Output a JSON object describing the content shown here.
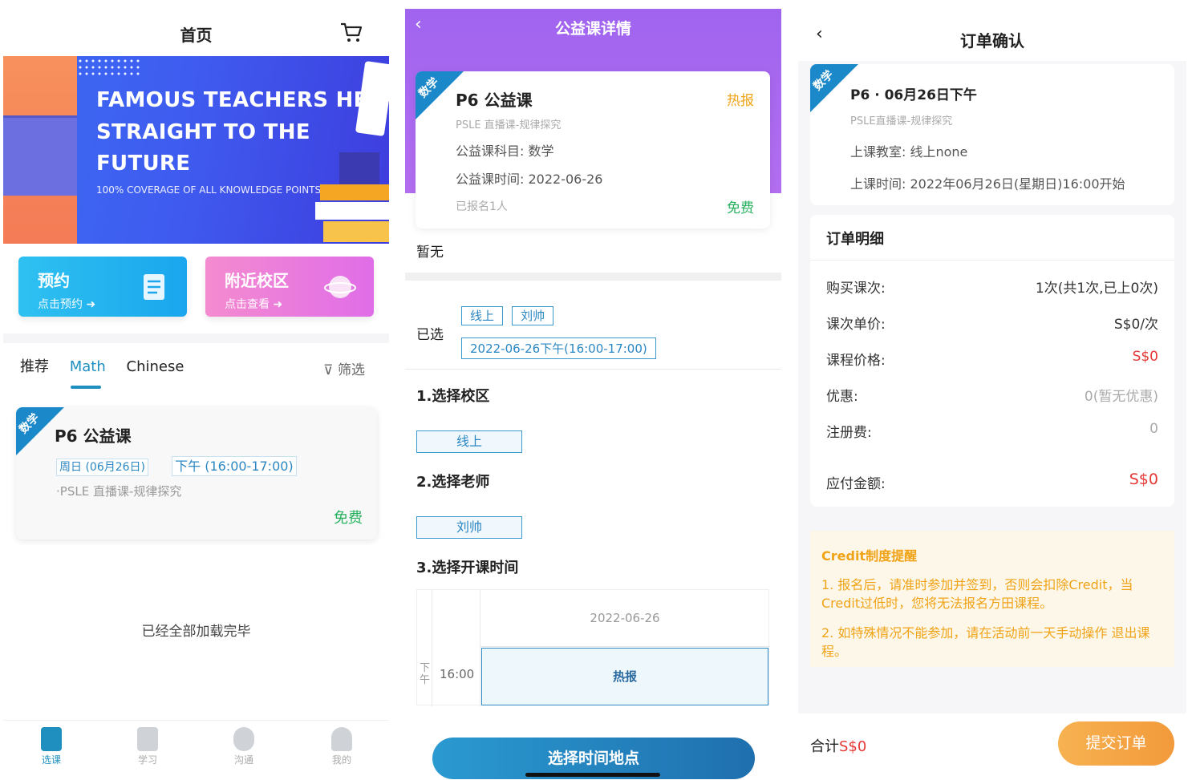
{
  "screen1": {
    "title": "首页",
    "banner": {
      "line1": "FAMOUS TEACHERS HELP",
      "line2": "STRAIGHT TO THE",
      "line3": "FUTURE",
      "subtitle": "100% COVERAGE OF ALL KNOWLEDGE POINTS"
    },
    "quick": [
      {
        "title": "预约",
        "sub": "点击预约"
      },
      {
        "title": "附近校区",
        "sub": "点击查看"
      }
    ],
    "tabs": [
      "推荐",
      "Math",
      "Chinese"
    ],
    "filter": "筛选",
    "course": {
      "corner": "数学",
      "title": "P6 公益课",
      "date_tag": "周日 (06月26日)",
      "time_tag": "下午 (16:00-17:00)",
      "subtitle": "·PSLE 直播课-规律探究",
      "price": "免费"
    },
    "loaded": "已经全部加载完毕",
    "nav": [
      "选课",
      "学习",
      "沟通",
      "我的"
    ]
  },
  "screen2": {
    "title": "公益课详情",
    "card": {
      "corner": "数学",
      "title": "P6 公益课",
      "hot": "热报",
      "subtitle": "PSLE 直播课-规律探究",
      "subject": "公益课科目: 数学",
      "time": "公益课时间: 2022-06-26",
      "enrolled": "已报名1人",
      "price": "免费"
    },
    "none": "暂无",
    "selected_label": "已选",
    "chips": [
      "线上",
      "刘帅"
    ],
    "chip_time": "2022-06-26下午(16:00-17:00)",
    "sec1": "1.选择校区",
    "opt1": "线上",
    "sec2": "2.选择老师",
    "opt2": "刘帅",
    "sec3": "3.选择开课时间",
    "grid": {
      "date": "2022-06-26",
      "period": "下午",
      "time": "16:00",
      "slot": "热报"
    },
    "button": "选择时间地点"
  },
  "screen3": {
    "title": "订单确认",
    "card": {
      "corner": "数学",
      "title": "P6 · 06月26日下午",
      "subtitle": "PSLE直播课-规律探究",
      "room": "上课教室:  线上none",
      "time": "上课时间:  2022年06月26日(星期日)16:00开始"
    },
    "detail_title": "订单明细",
    "rows": [
      {
        "label": "购买课次:",
        "value": "1次(共1次,已上0次)"
      },
      {
        "label": "课次单价:",
        "value": "S$0/次"
      },
      {
        "label": "课程价格:",
        "value": "S$0"
      },
      {
        "label": "优惠:",
        "value": "0(暂无优惠)"
      },
      {
        "label": "注册费:",
        "value": "0"
      },
      {
        "label": "应付金额:",
        "value": "S$0"
      }
    ],
    "credit": {
      "title": "Credit制度提醒",
      "p1": "1. 报名后，请准时参加并签到，否则会扣除Credit，当Credit过低时，您将无法报名方田课程。",
      "p2": "2. 如特殊情况不能参加，请在活动前一天手动操作 退出课程。"
    },
    "total_label": "合计",
    "total_value": "S$0",
    "submit": "提交订单"
  },
  "colors": {
    "accent_blue": "#1f8fbf",
    "purple": "#a064ef",
    "orange": "#f29a3b",
    "red": "#e53935",
    "green": "#27b15f"
  }
}
